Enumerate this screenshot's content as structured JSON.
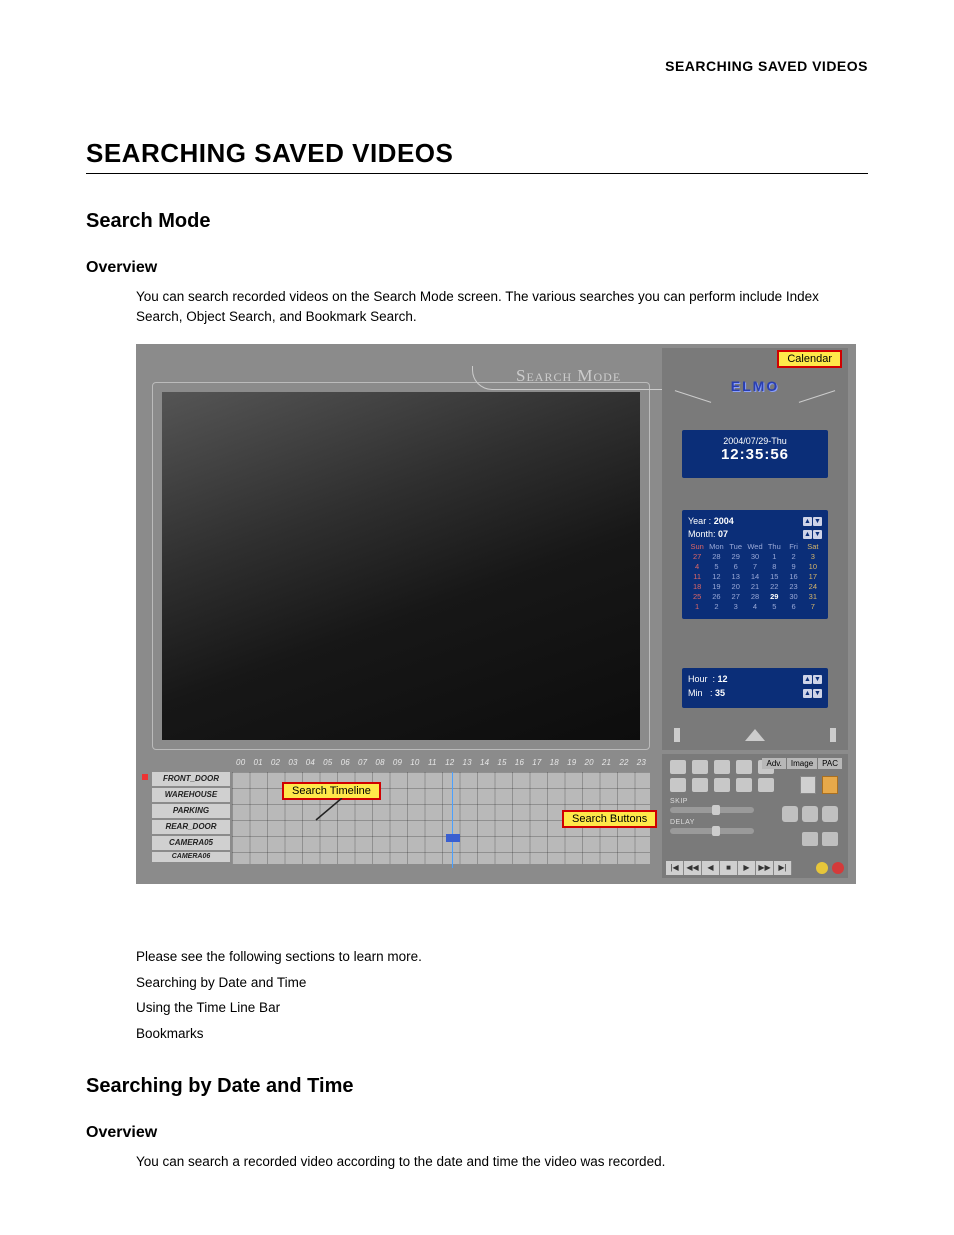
{
  "running_header": "SEARCHING SAVED VIDEOS",
  "h1": "SEARCHING SAVED VIDEOS",
  "sec1": {
    "h2": "Search Mode",
    "h3": "Overview",
    "body": "You can search recorded videos on the Search Mode screen. The various searches you can perform include Index Search, Object Search, and Bookmark Search."
  },
  "screenshot": {
    "title": "Search Mode",
    "logo": "ELMO",
    "callout_calendar": "Calendar",
    "callout_timeline": "Search Timeline",
    "callout_buttons": "Search Buttons",
    "clock": {
      "date": "2004/07/29-Thu",
      "time": "12:35:56"
    },
    "calendar": {
      "year_label": "Year :",
      "year": "2004",
      "month_label": "Month:",
      "month": "07",
      "day_headers": [
        "Sun",
        "Mon",
        "Tue",
        "Wed",
        "Thu",
        "Fri",
        "Sat"
      ],
      "weeks": [
        [
          "27",
          "28",
          "29",
          "30",
          "1",
          "2",
          "3"
        ],
        [
          "4",
          "5",
          "6",
          "7",
          "8",
          "9",
          "10"
        ],
        [
          "11",
          "12",
          "13",
          "14",
          "15",
          "16",
          "17"
        ],
        [
          "18",
          "19",
          "20",
          "21",
          "22",
          "23",
          "24"
        ],
        [
          "25",
          "26",
          "27",
          "28",
          "29",
          "30",
          "31"
        ],
        [
          "1",
          "2",
          "3",
          "4",
          "5",
          "6",
          "7"
        ]
      ],
      "selected_day": "29",
      "hour_label": "Hour",
      "hour_value": "12",
      "min_label": "Min",
      "min_value": "35"
    },
    "timeline_hours": [
      "00",
      "01",
      "02",
      "03",
      "04",
      "05",
      "06",
      "07",
      "08",
      "09",
      "10",
      "11",
      "12",
      "13",
      "14",
      "15",
      "16",
      "17",
      "18",
      "19",
      "20",
      "21",
      "22",
      "23"
    ],
    "cameras": [
      "FRONT_DOOR",
      "WAREHOUSE",
      "PARKING",
      "REAR_DOOR",
      "CAMERA05",
      "CAMERA06"
    ],
    "tabs": [
      "Adv.",
      "Image",
      "PAC"
    ],
    "slider_skip": "SKIP",
    "slider_delay": "DELAY",
    "transport": [
      "|◀",
      "◀◀",
      "◀",
      "■",
      "▶",
      "▶▶",
      "▶|"
    ]
  },
  "after": {
    "lead": "Please see the following sections to learn more.",
    "items": [
      "Searching by Date and Time",
      "Using the Time Line Bar",
      "Bookmarks"
    ]
  },
  "sec2": {
    "h2": "Searching by Date and Time",
    "h3": "Overview",
    "body": "You can search a recorded video according to the date and time the video was recorded."
  }
}
